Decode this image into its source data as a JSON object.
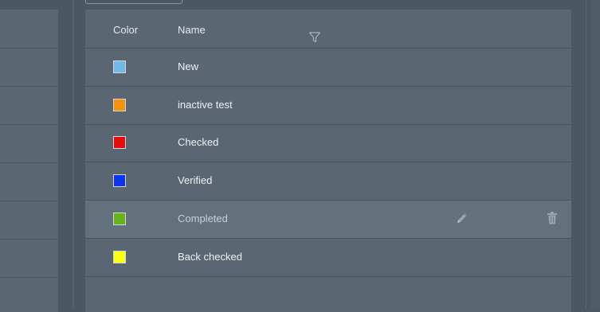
{
  "table": {
    "headers": {
      "color": "Color",
      "name": "Name"
    },
    "icons": {
      "filter": "filter-icon",
      "edit": "pencil-icon",
      "delete": "trash-icon"
    },
    "rows": [
      {
        "name": "New",
        "color": "#74b6e6"
      },
      {
        "name": "inactive test",
        "color": "#f3930f"
      },
      {
        "name": "Checked",
        "color": "#e80c0c"
      },
      {
        "name": "Verified",
        "color": "#0b35f0"
      },
      {
        "name": "Completed",
        "color": "#64b319"
      },
      {
        "name": "Back checked",
        "color": "#ffff13"
      }
    ],
    "hovered_row_index": 4
  }
}
